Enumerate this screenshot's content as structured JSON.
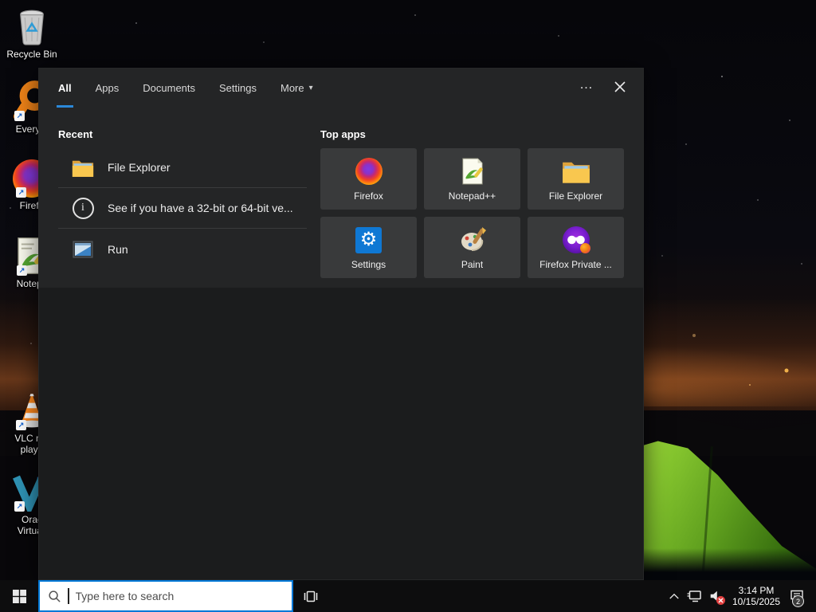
{
  "colors": {
    "accent_blue": "#0078d7",
    "tab_underline": "#2b88d8",
    "tile_bg": "#393a3b",
    "panel_bg": "#242526",
    "taskbar_bg": "#0d0d0e",
    "tent_green": "#7fc22c",
    "mute_red": "#e03f3f"
  },
  "desktop": {
    "icons": [
      {
        "label": "Recycle Bin"
      },
      {
        "label": "Everyth"
      },
      {
        "label": "Firefo"
      },
      {
        "label": "Notepa"
      },
      {
        "line1": "VLC me",
        "line2": "playe"
      },
      {
        "line1": "Orac",
        "line2": "Virtuall"
      }
    ]
  },
  "search_panel": {
    "tabs": [
      {
        "label": "All"
      },
      {
        "label": "Apps"
      },
      {
        "label": "Documents"
      },
      {
        "label": "Settings"
      },
      {
        "label": "More"
      }
    ],
    "more_arrow": "▾",
    "overflow_icon": "…",
    "recent": {
      "header": "Recent",
      "items": [
        {
          "label": "File Explorer"
        },
        {
          "label": "See if you have a 32-bit or 64-bit ve..."
        },
        {
          "label": "Run"
        }
      ]
    },
    "top_apps": {
      "header": "Top apps",
      "items": [
        {
          "label": "Firefox"
        },
        {
          "label": "Notepad++"
        },
        {
          "label": "File Explorer"
        },
        {
          "label": "Settings"
        },
        {
          "label": "Paint"
        },
        {
          "label": "Firefox Private ..."
        }
      ]
    },
    "settings_gear": "⚙"
  },
  "taskbar": {
    "search_placeholder": "Type here to search",
    "clock": {
      "time": "3:14 PM",
      "date": "10/15/2025"
    },
    "notification_badge": "2",
    "shortcut_arrow": "↗"
  }
}
